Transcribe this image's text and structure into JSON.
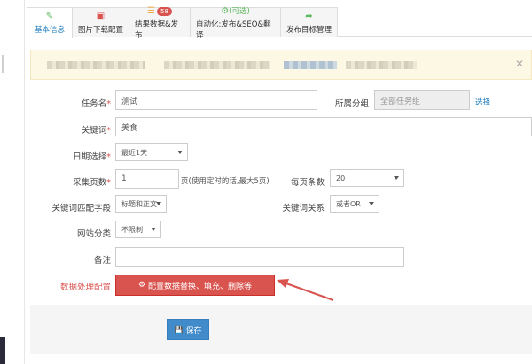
{
  "tabs": [
    {
      "label": "基本信息",
      "icon": "edit-icon"
    },
    {
      "label": "图片下载配置",
      "icon": "image-icon"
    },
    {
      "label": "结果数据&发布",
      "icon": "database-icon",
      "badge": "58"
    },
    {
      "label": "自动化:发布&SEO&翻译",
      "icon_label": "(可选)",
      "icon": "gears-icon"
    },
    {
      "label": "发布目标管理",
      "icon": "share-icon"
    }
  ],
  "form": {
    "task_name_label": "任务名",
    "task_name_value": "测试",
    "group_label": "所属分组",
    "group_value": "全部任务组",
    "group_select_link": "选择",
    "keyword_label": "关键词",
    "keyword_value": "美食",
    "date_label": "日期选择",
    "date_value": "最近1天",
    "pages_label": "采集页数",
    "pages_value": "1",
    "pages_hint": "页(使用定时的话,最大5页)",
    "per_page_label": "每页条数",
    "per_page_value": "20",
    "match_field_label": "关键词匹配字段",
    "match_field_value": "标题和正文",
    "relation_label": "关键词关系",
    "relation_value": "或者OR",
    "site_cat_label": "网站分类",
    "site_cat_value": "不限制",
    "remark_label": "备注",
    "remark_value": "",
    "data_proc_label": "数据处理配置",
    "data_proc_button": "配置数据替换、填充、删除等",
    "required_mark": "*"
  },
  "actions": {
    "save_label": "保存"
  },
  "colors": {
    "accent_blue": "#1a7bbf",
    "danger_red": "#d9534f",
    "primary_blue": "#428bca",
    "notice_bg": "#fcf8e3"
  }
}
